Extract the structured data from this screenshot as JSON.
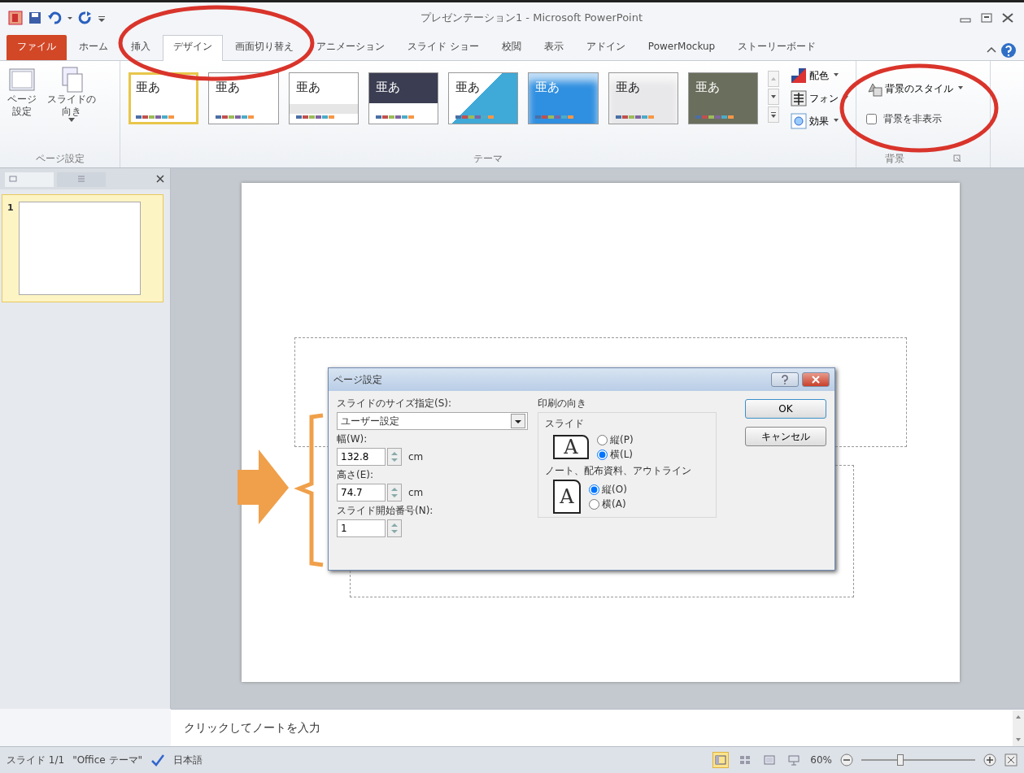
{
  "window": {
    "title": "プレゼンテーション1 - Microsoft PowerPoint"
  },
  "tabs": [
    {
      "label": "ファイル",
      "kind": "file",
      "selected": false
    },
    {
      "label": "ホーム",
      "kind": "tab",
      "selected": false
    },
    {
      "label": "挿入",
      "kind": "tab",
      "selected": false
    },
    {
      "label": "デザイン",
      "kind": "tab",
      "selected": true
    },
    {
      "label": "画面切り替え",
      "kind": "tab",
      "selected": false
    },
    {
      "label": "アニメーション",
      "kind": "tab",
      "selected": false
    },
    {
      "label": "スライド ショー",
      "kind": "tab",
      "selected": false
    },
    {
      "label": "校閲",
      "kind": "tab",
      "selected": false
    },
    {
      "label": "表示",
      "kind": "tab",
      "selected": false
    },
    {
      "label": "アドイン",
      "kind": "tab",
      "selected": false
    },
    {
      "label": "PowerMockup",
      "kind": "tab",
      "selected": false
    },
    {
      "label": "ストーリーボード",
      "kind": "tab",
      "selected": false
    }
  ],
  "ribbon": {
    "page_setup": {
      "label": "ページ設定",
      "buttons": [
        {
          "label": "ページ設定",
          "kind": "page",
          "dropdown": false
        },
        {
          "label": "スライドの向き",
          "kind": "orientation",
          "dropdown": true
        }
      ]
    },
    "themes": {
      "label": "テーマ",
      "items": [
        {
          "label": "亜あ",
          "kind": "plain",
          "color": "#ffffff",
          "selected": true
        },
        {
          "label": "亜あ",
          "kind": "plain",
          "color": "#ffffff",
          "selected": false
        },
        {
          "label": "亜あ",
          "kind": "boxed",
          "color": "#ffffff",
          "selected": false
        },
        {
          "label": "亜あ",
          "kind": "banner",
          "color": "#3b3e52",
          "selected": false
        },
        {
          "label": "亜あ",
          "kind": "diagonal",
          "color": "#3fa9d8",
          "selected": false
        },
        {
          "label": "亜あ",
          "kind": "gradient",
          "color": "#2f8fe0",
          "selected": false
        },
        {
          "label": "亜あ",
          "kind": "gradient",
          "color": "#e8e8ea",
          "selected": false
        },
        {
          "label": "亜あ",
          "kind": "banner",
          "color": "#6a6e5c",
          "selected": false
        }
      ]
    },
    "theme_options": [
      {
        "label": "配色",
        "kind": "colors"
      },
      {
        "label": "フォン",
        "kind": "fonts"
      },
      {
        "label": "効果",
        "kind": "effects"
      }
    ],
    "background": {
      "label": "背景",
      "style_button": "背景のスタイル",
      "hide": {
        "label": "背景を非表示",
        "checked": false
      }
    }
  },
  "slide_pane": {
    "thumbnails": [
      {
        "number": "1",
        "selected": true
      }
    ]
  },
  "dialog": {
    "title": "ページ設定",
    "size_label": "スライドのサイズ指定(S):",
    "size_value": "ユーザー設定",
    "fields": [
      {
        "label": "幅(W):",
        "value": "132.8",
        "unit": "cm"
      },
      {
        "label": "高さ(E):",
        "value": "74.7",
        "unit": "cm"
      },
      {
        "label": "スライド開始番号(N):",
        "value": "1"
      }
    ],
    "orientation": {
      "label": "印刷の向き",
      "groups": [
        {
          "label": "スライド",
          "preview": "A",
          "kind": "landscape",
          "options": [
            {
              "label": "縦(P)",
              "selected": false
            },
            {
              "label": "横(L)",
              "selected": true
            }
          ]
        },
        {
          "label": "ノート、配布資料、アウトライン",
          "preview": "A",
          "kind": "portrait",
          "options": [
            {
              "label": "縦(O)",
              "selected": true
            },
            {
              "label": "横(A)",
              "selected": false
            }
          ]
        }
      ]
    },
    "buttons": [
      "OK",
      "キャンセル"
    ]
  },
  "notes": {
    "placeholder": "クリックしてノートを入力"
  },
  "status_bar": {
    "slide": "スライド 1/1",
    "theme": "\"Office テーマ\"",
    "language": "日本語",
    "views": [
      {
        "kind": "normal",
        "selected": true
      },
      {
        "kind": "sorter",
        "selected": false
      },
      {
        "kind": "reading",
        "selected": false
      },
      {
        "kind": "show",
        "selected": false
      }
    ],
    "zoom": "60%",
    "zoom_slider": {
      "level": 0.33
    }
  }
}
